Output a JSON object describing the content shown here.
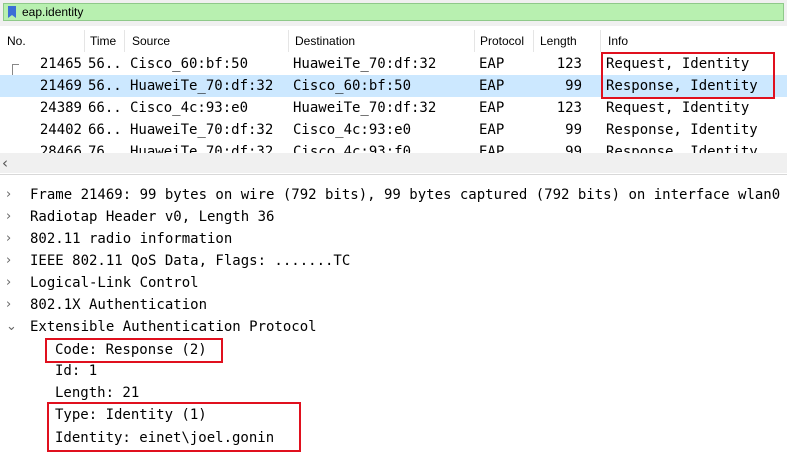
{
  "filter": {
    "value": "eap.identity"
  },
  "columns": [
    "No.",
    "Time",
    "Source",
    "Destination",
    "Protocol",
    "Length",
    "Info"
  ],
  "packets": [
    {
      "no": "21465",
      "time": "56...",
      "source": "Cisco_60:bf:50",
      "destination": "HuaweiTe_70:df:32",
      "protocol": "EAP",
      "length": "123",
      "info": "Request, Identity"
    },
    {
      "no": "21469",
      "time": "56...",
      "source": "HuaweiTe_70:df:32",
      "destination": "Cisco_60:bf:50",
      "protocol": "EAP",
      "length": "99",
      "info": "Response, Identity"
    },
    {
      "no": "24389",
      "time": "66...",
      "source": "Cisco_4c:93:e0",
      "destination": "HuaweiTe_70:df:32",
      "protocol": "EAP",
      "length": "123",
      "info": "Request, Identity"
    },
    {
      "no": "24402",
      "time": "66...",
      "source": "HuaweiTe_70:df:32",
      "destination": "Cisco_4c:93:e0",
      "protocol": "EAP",
      "length": "99",
      "info": "Response, Identity"
    },
    {
      "no": "28466",
      "time": "76...",
      "source": "HuaweiTe_70:df:32",
      "destination": "Cisco_4c:93:f0",
      "protocol": "EAP",
      "length": "99",
      "info": "Response, Identity"
    }
  ],
  "details": [
    "Frame 21469: 99 bytes on wire (792 bits), 99 bytes captured (792 bits) on interface wlan0",
    "Radiotap Header v0, Length 36",
    "802.11 radio information",
    "IEEE 802.11 QoS Data, Flags: .......TC",
    "Logical-Link Control",
    "802.1X Authentication",
    "Extensible Authentication Protocol"
  ],
  "eap_fields": [
    "Code: Response (2)",
    "Id: 1",
    "Length: 21",
    "Type: Identity (1)",
    "Identity: einet\\joel.gonin"
  ],
  "icons": {
    "filter": "bookmark-icon",
    "collapsed": "chevron-right-icon",
    "expanded": "chevron-down-icon",
    "scroll_left": "chevron-left-icon"
  },
  "colors": {
    "filter_bg": "#b8f0b0",
    "selected_row": "#cce8ff",
    "highlight_box": "#e0101e"
  }
}
